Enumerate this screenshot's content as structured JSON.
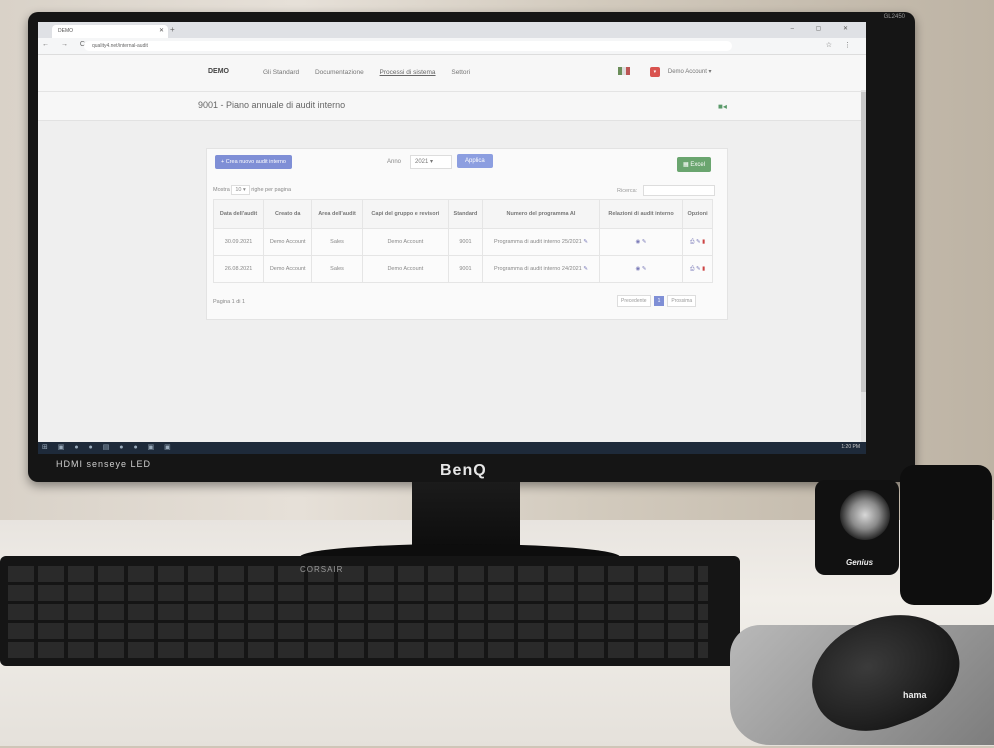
{
  "monitor": {
    "brand": "BenQ",
    "model_label": "GL2450",
    "bottom_left_label": "HDMI senseye LED"
  },
  "browser": {
    "tab_title": "DEMO",
    "url": "quality4.net/internal-audit",
    "nav_icons": "← → C",
    "toolbar_icons": "☆ ⋮"
  },
  "app": {
    "logo": "DEMO",
    "menu": [
      "Gli Standard",
      "Documentazione",
      "Processi di sistema",
      "Settori"
    ],
    "active_menu": "Processi di sistema",
    "user_menu": "Demo Account ▾",
    "page_title": "9001 - Piano annuale di audit interno"
  },
  "toolbar": {
    "new_audit_button": "+ Crea nuovo audit interno",
    "year_label": "Anno",
    "year_value": "2021 ▾",
    "apply_button": "Applica",
    "excel_button": "Excel"
  },
  "table_controls": {
    "show_prefix": "Mostra",
    "show_value": "10 ▾",
    "show_suffix": "righe per pagina",
    "search_label": "Ricerca:"
  },
  "table": {
    "headers": [
      "Data dell'audit",
      "Creato da",
      "Area dell'audit",
      "Capi del gruppo e revisori",
      "Standard",
      "Numero del programma AI",
      "Relazioni di audit interno",
      "Opzioni"
    ],
    "rows": [
      {
        "date": "30.09.2021",
        "created_by": "Demo Account",
        "area": "Sales",
        "leaders": "Demo Account",
        "standard": "9001",
        "program": "Programma di audit interno 25/2021"
      },
      {
        "date": "26.08.2021",
        "created_by": "Demo Account",
        "area": "Sales",
        "leaders": "Demo Account",
        "standard": "9001",
        "program": "Programma di audit interno 24/2021"
      }
    ]
  },
  "pagination": {
    "info": "Pagina 1 di 1",
    "prev": "Precedente",
    "current": "1",
    "next": "Prossima"
  },
  "taskbar": {
    "clock": "1:20 PM"
  },
  "peripherals": {
    "keyboard_brand": "CORSAIR",
    "mouse_brand": "hama",
    "speaker_brand": "Genius"
  }
}
